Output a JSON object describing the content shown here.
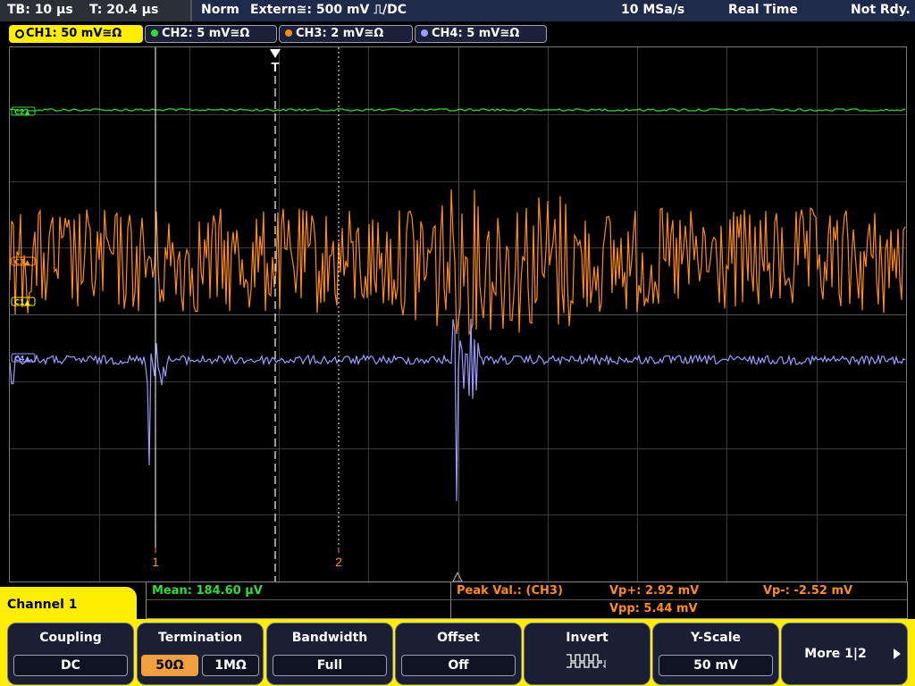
{
  "topbar": {
    "tb": "TB: 10 µs",
    "t": "T: 20.4 µs",
    "mode": "Norm",
    "trigger": "Extern≅: 500 mV ⎍/DC",
    "sample_rate": "10 MSa/s",
    "acq_mode": "Real Time",
    "status": "Not Rdy."
  },
  "channels": [
    {
      "label": "CH1: 50 mV≅Ω",
      "color": "#ffee00",
      "active": true
    },
    {
      "label": "CH2: 5 mV≅Ω",
      "color": "#33dd33",
      "active": false
    },
    {
      "label": "CH3: 2 mV≅Ω",
      "color": "#ff8c1a",
      "active": false
    },
    {
      "label": "CH4: 5 mV≅Ω",
      "color": "#9b9bff",
      "active": false
    }
  ],
  "markers": {
    "trigger": "T",
    "cursor1": "1",
    "cursor2": "2",
    "ch_c2": "C2▲",
    "ch_c3": "C3▲",
    "ch_c1": "C1▲",
    "ch_c4": "C4▲"
  },
  "measurements": {
    "mean": "Mean: 184.60 µV",
    "peak_label": "Peak Val.:  (CH3)",
    "vp_plus": "Vp+: 2.92 mV",
    "vp_minus": "Vp-: -2.52 mV",
    "vpp": "Vpp: 5.44 mV"
  },
  "menu": {
    "tab_title": "Channel 1",
    "coupling": {
      "title": "Coupling",
      "value": "DC"
    },
    "termination": {
      "title": "Termination",
      "opt1": "50Ω",
      "opt2": "1MΩ"
    },
    "bandwidth": {
      "title": "Bandwidth",
      "value": "Full"
    },
    "offset": {
      "title": "Offset",
      "value": "Off"
    },
    "invert": {
      "title": "Invert"
    },
    "yscale": {
      "title": "Y-Scale",
      "value": "50 mV"
    },
    "more": {
      "label": "More 1|2"
    }
  },
  "colors": {
    "ch1": "#ffee00",
    "ch2": "#33dd33",
    "ch3": "#ff8c1a",
    "ch4": "#9b9bff",
    "cursor": "#ff8c1a"
  }
}
